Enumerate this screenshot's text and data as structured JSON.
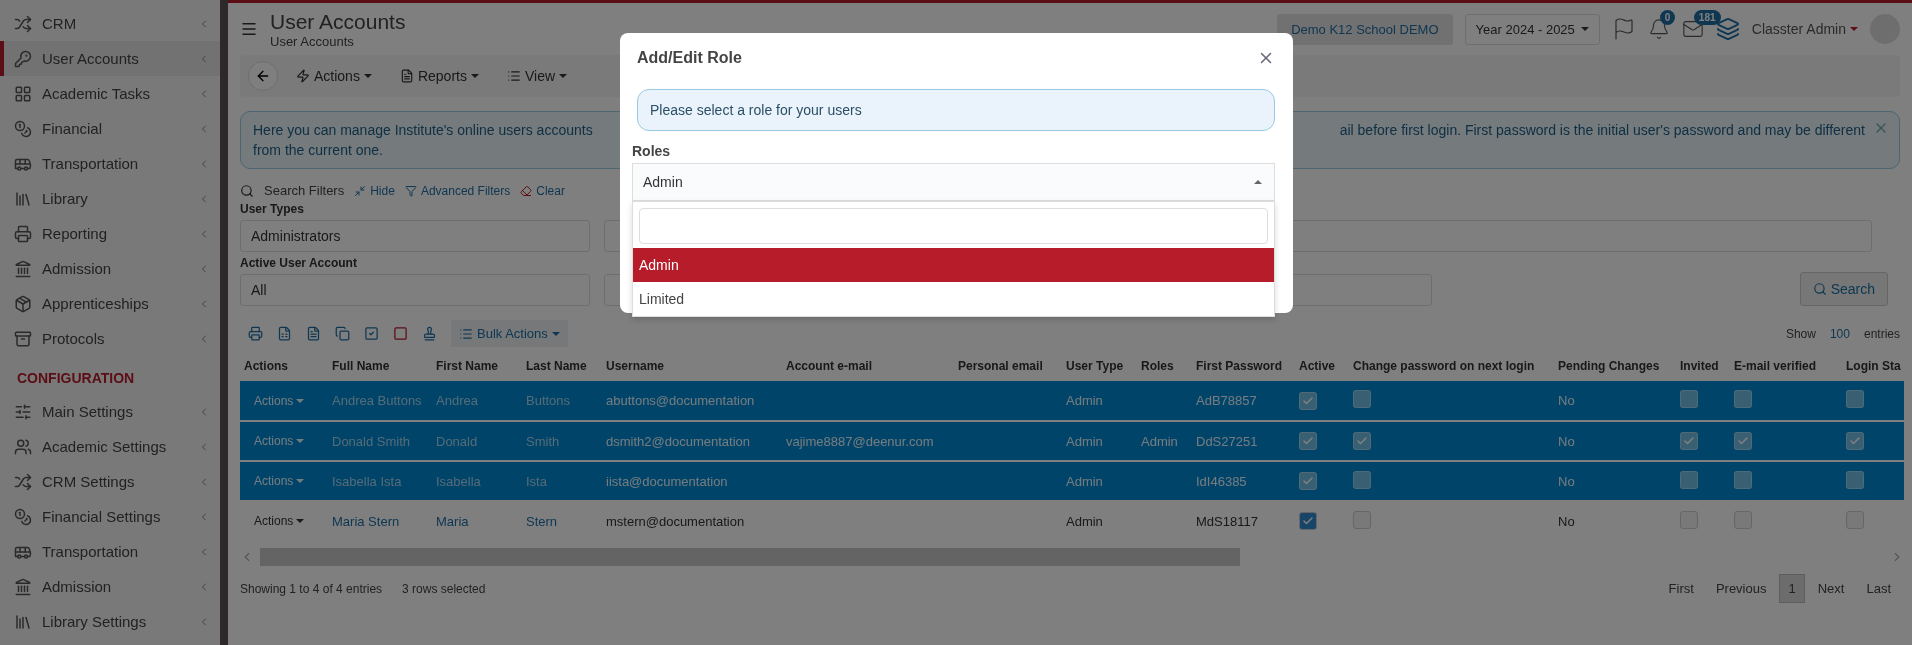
{
  "sidebar": {
    "sections": [
      {
        "items": [
          {
            "label": "CRM",
            "selected": false
          },
          {
            "label": "User Accounts",
            "selected": true
          },
          {
            "label": "Academic Tasks",
            "selected": false
          },
          {
            "label": "Financial",
            "selected": false
          },
          {
            "label": "Transportation",
            "selected": false
          },
          {
            "label": "Library",
            "selected": false
          },
          {
            "label": "Reporting",
            "selected": false
          },
          {
            "label": "Admission",
            "selected": false
          },
          {
            "label": "Apprenticeships",
            "selected": false
          },
          {
            "label": "Protocols",
            "selected": false
          }
        ]
      },
      {
        "heading": "CONFIGURATION",
        "items": [
          {
            "label": "Main Settings",
            "selected": false
          },
          {
            "label": "Academic Settings",
            "selected": false
          },
          {
            "label": "CRM Settings",
            "selected": false
          },
          {
            "label": "Financial Settings",
            "selected": false
          },
          {
            "label": "Transportation",
            "selected": false
          },
          {
            "label": "Admission",
            "selected": false
          },
          {
            "label": "Library Settings",
            "selected": false
          }
        ]
      }
    ]
  },
  "header": {
    "title": "User Accounts",
    "subtitle": "User Accounts",
    "school": "Demo K12 School DEMO",
    "year": "Year 2024 - 2025",
    "notifications": "0",
    "messages": "181",
    "user": "Classter Admin"
  },
  "toolbar": {
    "menus": [
      "Actions",
      "Reports",
      "View"
    ]
  },
  "alert": {
    "left_lines": [
      "Here you can manage Institute's online users accounts",
      "from the current one."
    ],
    "right_text": "ail before first login. First password is the initial user's password and may be different"
  },
  "filters": {
    "title": "Search Filters",
    "links": [
      "Hide",
      "Advanced Filters",
      "Clear"
    ],
    "fields": [
      {
        "label": "User Types",
        "value": "Administrators"
      },
      {
        "label": "Active User Account",
        "value": "All"
      }
    ],
    "search_button": "Search"
  },
  "table": {
    "bulk_actions": "Bulk Actions",
    "show_label": "Show",
    "page_size": "100",
    "entries_label": "entries",
    "columns": [
      "Actions",
      "Full Name",
      "First Name",
      "Last Name",
      "Username",
      "Account e-mail",
      "Personal email",
      "User Type",
      "Roles",
      "First Password",
      "Active",
      "Change password on next login",
      "Pending Changes",
      "Invited",
      "E-mail verified",
      "Login Sta"
    ],
    "rows": [
      {
        "selected": true,
        "action": "Actions",
        "full_name": "Andrea Buttons",
        "first_name": "Andrea",
        "last_name": "Buttons",
        "username": "abuttons@documentation",
        "user_type": "Admin",
        "first_password": "AdB78857",
        "active": true,
        "change_password": false,
        "pending": "No",
        "invited": false,
        "email_verified": false,
        "login_status": false
      },
      {
        "selected": true,
        "action": "Actions",
        "full_name": "Donald Smith",
        "first_name": "Donald",
        "last_name": "Smith",
        "username": "dsmith2@documentation",
        "account_email": "vajime8887@deenur.com",
        "user_type": "Admin",
        "roles": "Admin",
        "first_password": "DdS27251",
        "active": true,
        "change_password": true,
        "pending": "No",
        "invited": true,
        "email_verified": true,
        "login_status": true
      },
      {
        "selected": true,
        "action": "Actions",
        "full_name": "Isabella Ista",
        "first_name": "Isabella",
        "last_name": "Ista",
        "username": "iista@documentation",
        "user_type": "Admin",
        "first_password": "IdI46385",
        "active": true,
        "change_password": false,
        "pending": "No",
        "invited": false,
        "email_verified": false,
        "login_status": false
      },
      {
        "selected": false,
        "action": "Actions",
        "full_name": "Maria Stern",
        "first_name": "Maria",
        "last_name": "Stern",
        "username": "mstern@documentation",
        "user_type": "Admin",
        "first_password": "MdS18117",
        "active": true,
        "change_password": false,
        "pending": "No",
        "invited": false,
        "email_verified": false,
        "login_status": false
      }
    ]
  },
  "footer": {
    "info": "Showing 1 to 4 of 4 entries",
    "selected_info": "3 rows selected",
    "pages": [
      {
        "label": "First",
        "selected": false
      },
      {
        "label": "Previous",
        "selected": false
      },
      {
        "label": "1",
        "selected": true
      },
      {
        "label": "Next",
        "selected": false
      },
      {
        "label": "Last",
        "selected": false
      }
    ]
  },
  "modal": {
    "title": "Add/Edit Role",
    "info": "Please select a role for your users",
    "roles_label": "Roles",
    "value": "Admin",
    "options": [
      {
        "label": "Admin",
        "selected": true
      },
      {
        "label": "Limited",
        "selected": false
      }
    ]
  }
}
